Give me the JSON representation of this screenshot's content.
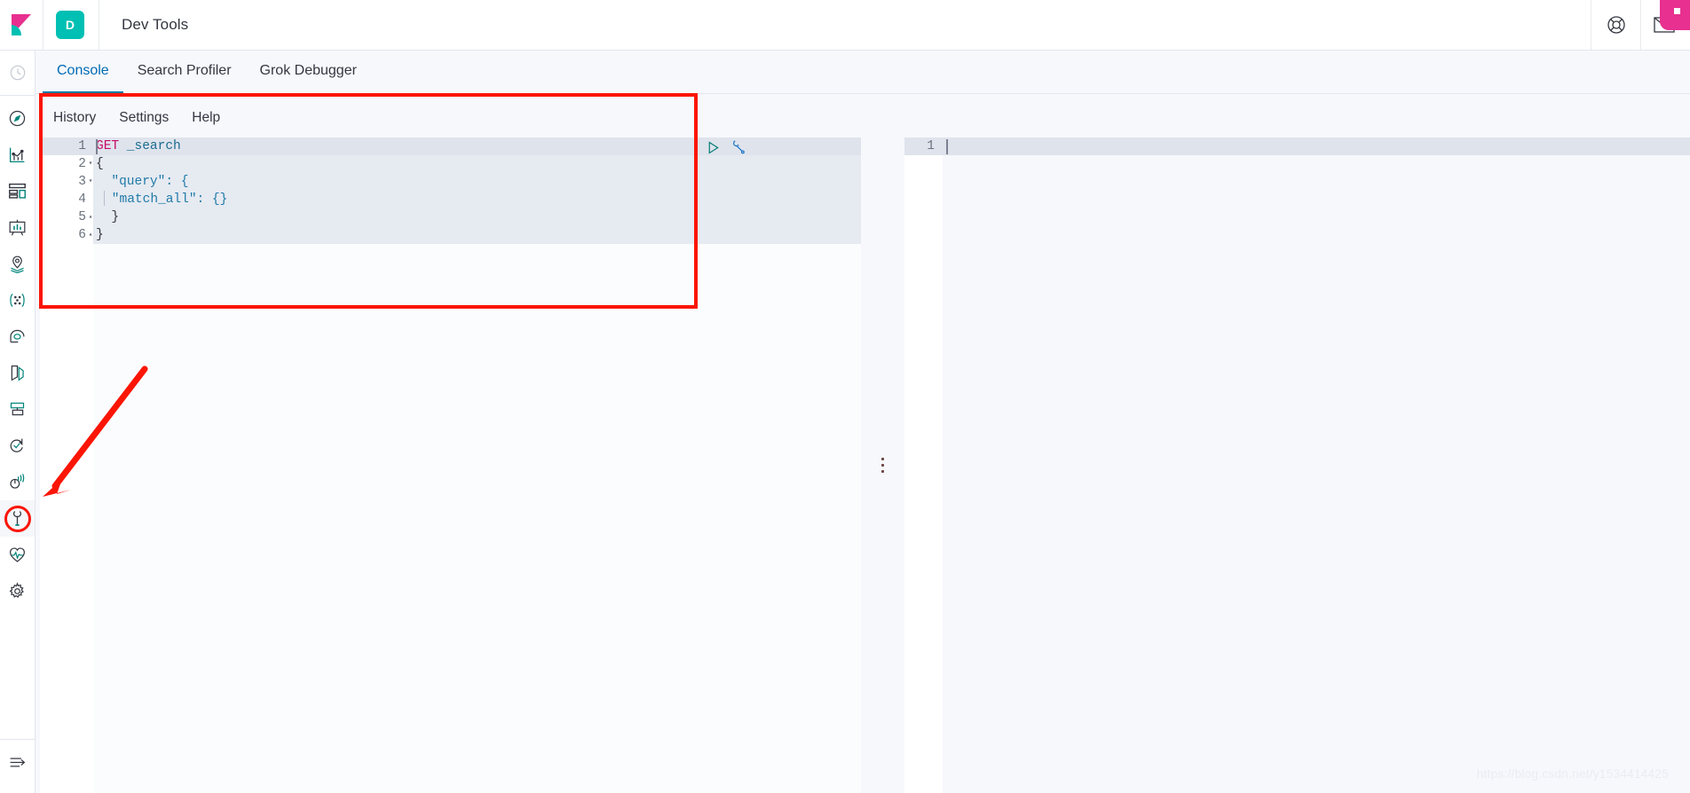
{
  "header": {
    "logo_icon": "kibana-logo-icon",
    "app_initial": "D",
    "title": "Dev Tools",
    "help_icon": "lifebuoy-help-icon",
    "mail_icon": "mail-envelope-icon",
    "notification_badge": ""
  },
  "sidebar": {
    "items": [
      {
        "name": "recently-viewed",
        "icon": "clock-icon"
      },
      {
        "name": "discover",
        "icon": "compass-icon"
      },
      {
        "name": "visualize",
        "icon": "bar-chart-icon"
      },
      {
        "name": "dashboard",
        "icon": "dashboard-grid-icon"
      },
      {
        "name": "canvas",
        "icon": "presentation-board-icon"
      },
      {
        "name": "maps",
        "icon": "map-pin-layers-icon"
      },
      {
        "name": "machine-learning",
        "icon": "graph-nodes-icon"
      },
      {
        "name": "infrastructure",
        "icon": "infrastructure-icon"
      },
      {
        "name": "logs",
        "icon": "logs-icon"
      },
      {
        "name": "apm",
        "icon": "apm-icon"
      },
      {
        "name": "uptime",
        "icon": "uptime-check-arrow-icon"
      },
      {
        "name": "siem",
        "icon": "siem-signal-icon"
      },
      {
        "name": "dev-tools",
        "icon": "wrench-icon",
        "active": true
      },
      {
        "name": "monitoring",
        "icon": "heartbeat-icon"
      },
      {
        "name": "management",
        "icon": "gear-icon"
      },
      {
        "name": "collapse-nav",
        "icon": "collapse-arrow-icon"
      }
    ]
  },
  "tabs": [
    {
      "label": "Console",
      "active": true
    },
    {
      "label": "Search Profiler",
      "active": false
    },
    {
      "label": "Grok Debugger",
      "active": false
    }
  ],
  "console": {
    "menu": [
      {
        "label": "History"
      },
      {
        "label": "Settings"
      },
      {
        "label": "Help"
      }
    ],
    "actions": {
      "play_icon": "play-triangle-icon",
      "wrench_icon": "wrench-icon"
    },
    "request_editor": {
      "lines": [
        {
          "no": "1",
          "fold": "",
          "method": "GET",
          "rest": " _search",
          "active": true
        },
        {
          "no": "2",
          "fold": "▾",
          "text": "{"
        },
        {
          "no": "3",
          "fold": "▾",
          "text": "  \"query\": {"
        },
        {
          "no": "4",
          "fold": "",
          "text": "    \"match_all\": {}"
        },
        {
          "no": "5",
          "fold": "▴",
          "text": "  }"
        },
        {
          "no": "6",
          "fold": "▴",
          "text": "}"
        }
      ]
    },
    "response_editor": {
      "lines": [
        {
          "no": "1",
          "text": ""
        }
      ]
    },
    "splitter_icon": "vertical-drag-handle-icon"
  },
  "annotations": {
    "highlight_box_color": "#fb1505",
    "arrow_color": "#fb1505",
    "arrow_target": "dev-tools-sidebar-icon"
  },
  "watermark": "https://blog.csdn.net/y1534414425"
}
